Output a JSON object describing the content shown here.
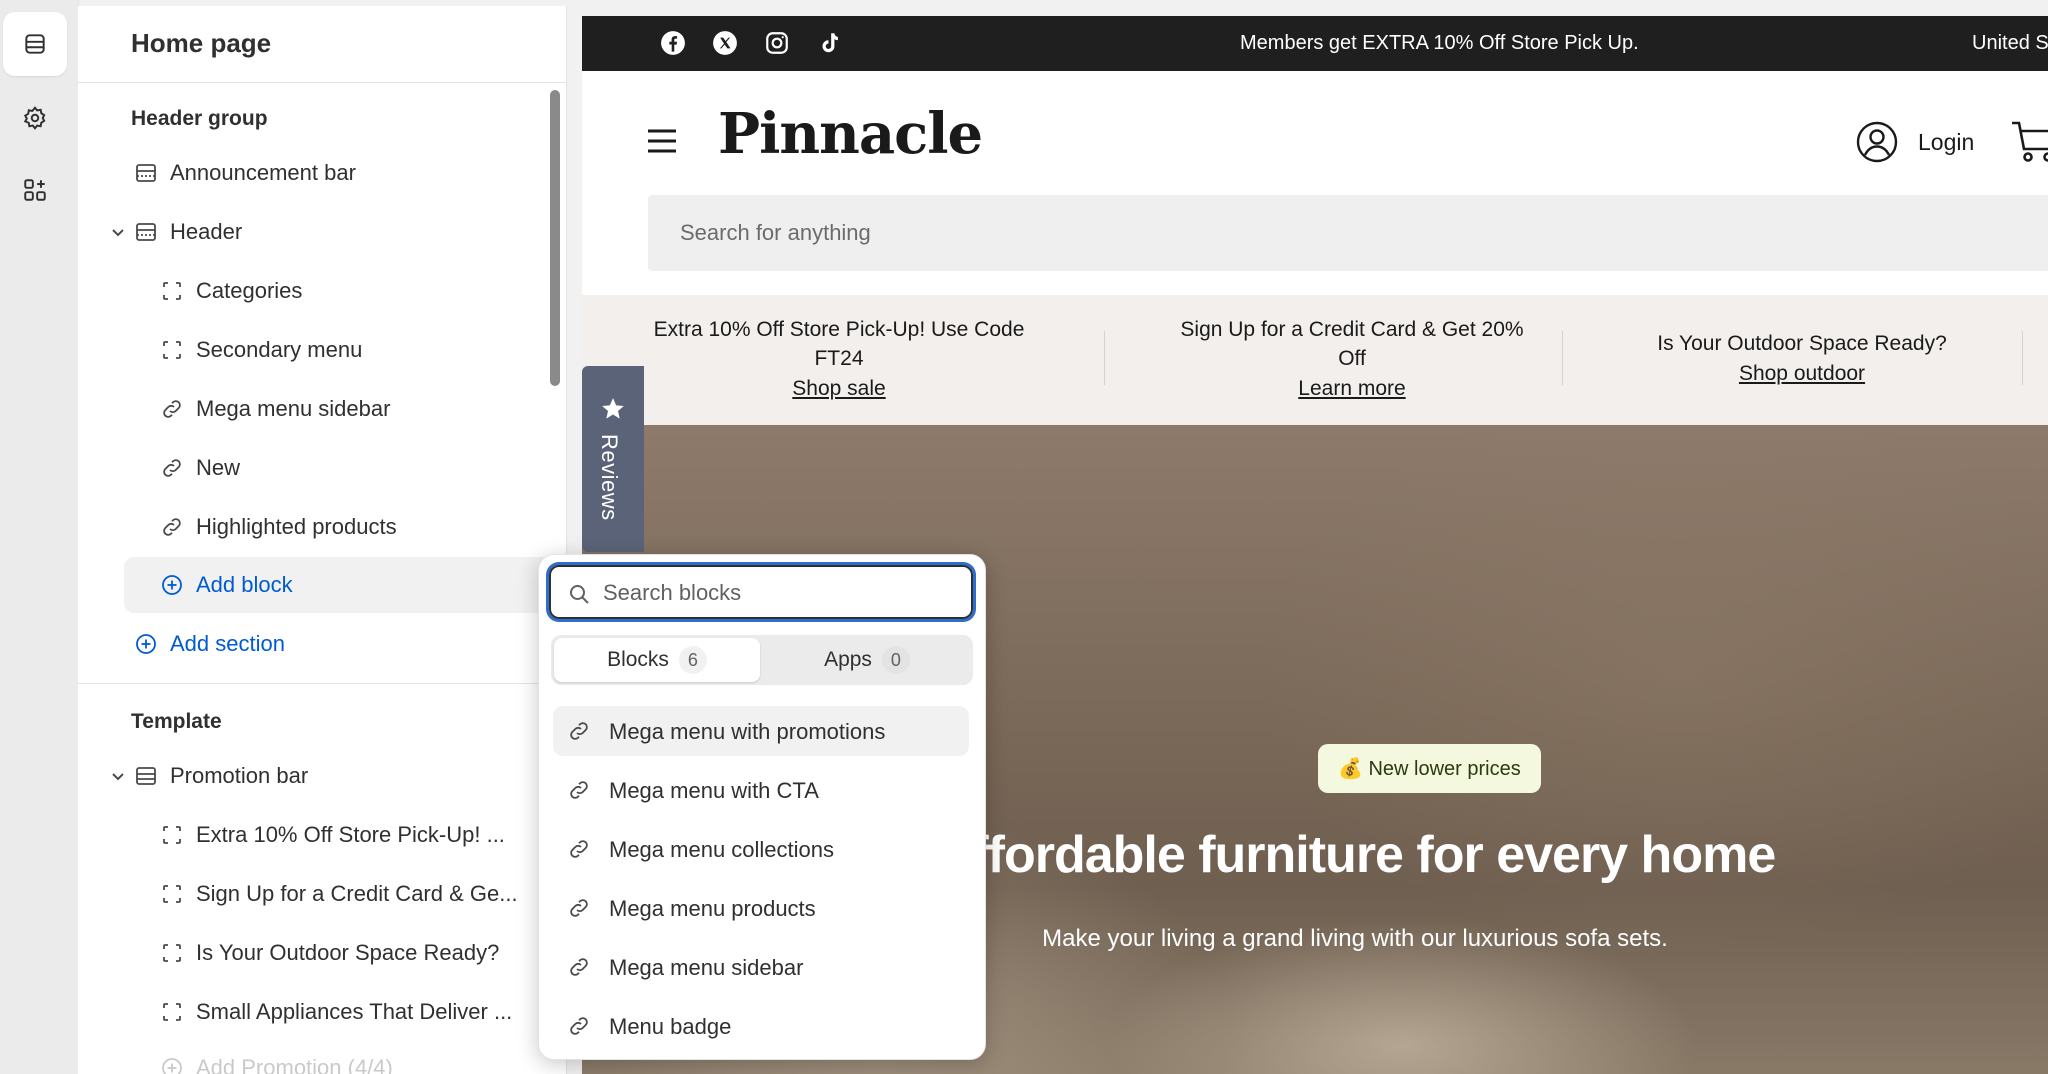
{
  "sidebar": {
    "title": "Home page",
    "header_group": {
      "label": "Header group",
      "items": [
        {
          "label": "Announcement bar",
          "icon": "section-icon"
        },
        {
          "label": "Header",
          "icon": "section-icon",
          "expanded": true
        },
        {
          "label": "Categories",
          "icon": "block-icon"
        },
        {
          "label": "Secondary menu",
          "icon": "block-icon"
        },
        {
          "label": "Mega menu sidebar",
          "icon": "link-icon"
        },
        {
          "label": "New",
          "icon": "link-icon"
        },
        {
          "label": "Highlighted products",
          "icon": "link-icon"
        }
      ],
      "add_block": "Add block",
      "add_section": "Add section"
    },
    "template": {
      "label": "Template",
      "items": [
        {
          "label": "Promotion bar",
          "icon": "section-icon",
          "expanded": true
        },
        {
          "label": "Extra 10% Off Store Pick-Up! ...",
          "icon": "block-icon"
        },
        {
          "label": "Sign Up for a Credit Card & Ge...",
          "icon": "block-icon"
        },
        {
          "label": "Is Your Outdoor Space Ready?",
          "icon": "block-icon"
        },
        {
          "label": "Small Appliances That Deliver ...",
          "icon": "block-icon"
        }
      ],
      "add_promotion": "Add Promotion (4/4)"
    }
  },
  "block_picker": {
    "search_placeholder": "Search blocks",
    "tabs": [
      {
        "label": "Blocks",
        "count": "6",
        "active": true
      },
      {
        "label": "Apps",
        "count": "0",
        "active": false
      }
    ],
    "items": [
      {
        "label": "Mega menu with promotions",
        "icon": "link-icon"
      },
      {
        "label": "Mega menu with CTA",
        "icon": "link-icon"
      },
      {
        "label": "Mega menu collections",
        "icon": "link-icon"
      },
      {
        "label": "Mega menu products",
        "icon": "link-icon"
      },
      {
        "label": "Mega menu sidebar",
        "icon": "link-icon"
      },
      {
        "label": "Menu badge",
        "icon": "link-icon"
      }
    ]
  },
  "store": {
    "announcement": "Members get EXTRA 10% Off Store Pick Up.",
    "country": "United S",
    "logo": "Pinnacle",
    "login": "Login",
    "search_placeholder": "Search for anything",
    "promos": [
      {
        "line1": "Extra 10% Off Store Pick-Up! Use Code",
        "line2": "FT24",
        "link": "Shop sale"
      },
      {
        "line1": "Sign Up for a Credit Card & Get 20%",
        "line2": "Off",
        "link": "Learn more"
      },
      {
        "line1": "Is Your Outdoor Space Ready?",
        "line2": "",
        "link": "Shop outdoor"
      }
    ],
    "reviews_tab": "Reviews",
    "hero": {
      "badge": "💰 New lower prices",
      "heading": "Affordable furniture for every home",
      "subheading": "Make your living a grand living with our luxurious sofa sets."
    }
  },
  "colors": {
    "accent": "#005bd3",
    "focus": "#2c6ecb",
    "announcement_bg": "#1f1f1f",
    "reviews_bg": "#5b6378",
    "badge_bg": "#f4f8de"
  }
}
